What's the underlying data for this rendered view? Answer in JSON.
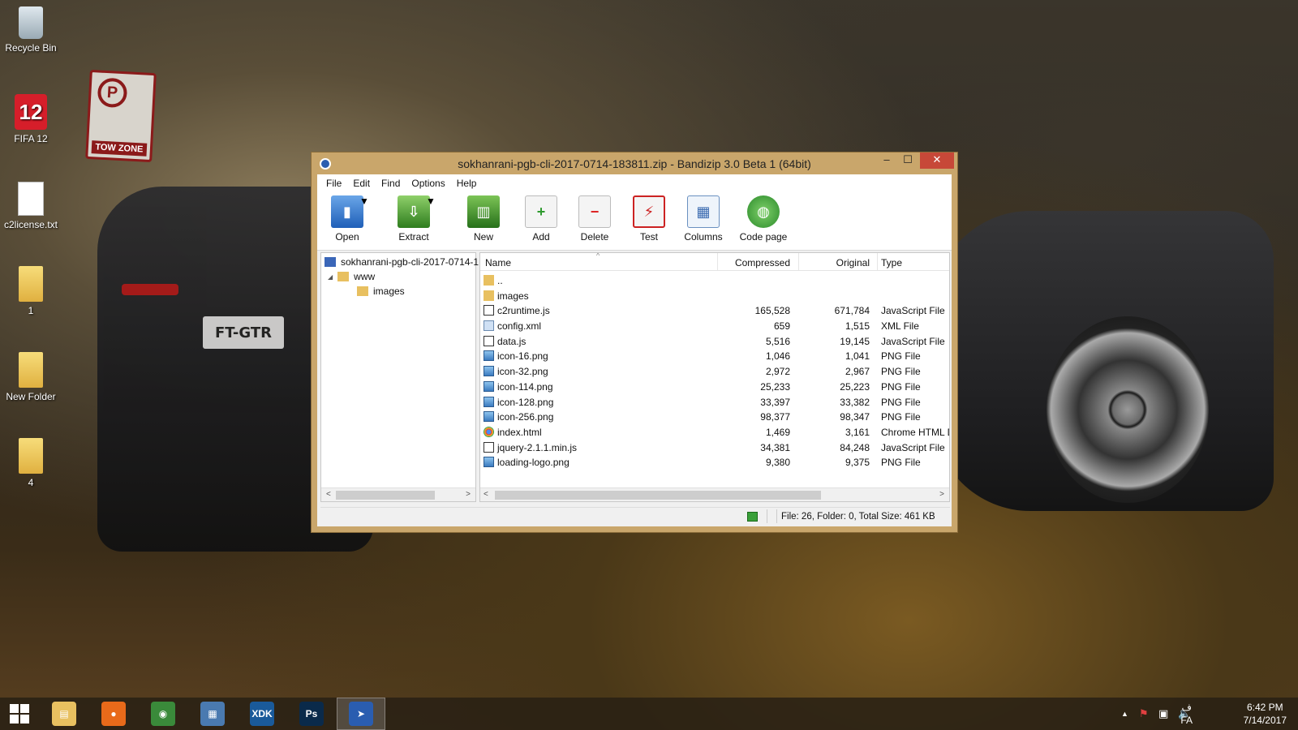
{
  "desktop": {
    "icons": [
      {
        "label": "Recycle Bin",
        "icon": "recycle-bin-icon"
      },
      {
        "label": "FIFA 12",
        "icon": "fifa-icon",
        "glyph": "12"
      },
      {
        "label": "c2license.txt",
        "icon": "text-file-icon"
      },
      {
        "label": "1",
        "icon": "folder-icon"
      },
      {
        "label": "New Folder",
        "icon": "folder-icon"
      },
      {
        "label": "4",
        "icon": "folder-icon"
      }
    ],
    "wallpaper": {
      "plate": "FT-GTR",
      "sign_text": "TOW ZONE",
      "sign_symbol": "P"
    }
  },
  "window": {
    "title": "sokhanrani-pgb-cli-2017-0714-183811.zip - Bandizip 3.0 Beta 1 (64bit)",
    "controls": {
      "minimize": "–",
      "maximize": "☐",
      "close": "✕"
    },
    "menu": [
      "File",
      "Edit",
      "Find",
      "Options",
      "Help"
    ],
    "toolbar": [
      {
        "label": "Open",
        "icon": "open-icon",
        "glyph": "▮"
      },
      {
        "label": "Extract",
        "icon": "extract-icon",
        "glyph": "⇩"
      },
      {
        "label": "New",
        "icon": "new-archive-icon",
        "glyph": "▥"
      },
      {
        "label": "Add",
        "icon": "add-file-icon",
        "glyph": "+"
      },
      {
        "label": "Delete",
        "icon": "delete-file-icon",
        "glyph": "−"
      },
      {
        "label": "Test",
        "icon": "test-icon",
        "glyph": "⚡"
      },
      {
        "label": "Columns",
        "icon": "columns-icon",
        "glyph": "▦"
      },
      {
        "label": "Code page",
        "icon": "globe-icon",
        "glyph": "◍"
      }
    ],
    "tree": [
      {
        "label": "sokhanrani-pgb-cli-2017-0714-1"
      },
      {
        "label": "www",
        "expander": "◢"
      },
      {
        "label": "images"
      }
    ],
    "columns": {
      "name": "Name",
      "compressed": "Compressed",
      "original": "Original",
      "type": "Type",
      "sort_indicator": "^"
    },
    "files": [
      {
        "name": "..",
        "compressed": "",
        "original": "",
        "type": "",
        "kind": "folder"
      },
      {
        "name": "images",
        "compressed": "",
        "original": "",
        "type": "",
        "kind": "folder"
      },
      {
        "name": "c2runtime.js",
        "compressed": "165,528",
        "original": "671,784",
        "type": "JavaScript File",
        "kind": "js"
      },
      {
        "name": "config.xml",
        "compressed": "659",
        "original": "1,515",
        "type": "XML File",
        "kind": "xml"
      },
      {
        "name": "data.js",
        "compressed": "5,516",
        "original": "19,145",
        "type": "JavaScript File",
        "kind": "js"
      },
      {
        "name": "icon-16.png",
        "compressed": "1,046",
        "original": "1,041",
        "type": "PNG File",
        "kind": "png"
      },
      {
        "name": "icon-32.png",
        "compressed": "2,972",
        "original": "2,967",
        "type": "PNG File",
        "kind": "png"
      },
      {
        "name": "icon-114.png",
        "compressed": "25,233",
        "original": "25,223",
        "type": "PNG File",
        "kind": "png"
      },
      {
        "name": "icon-128.png",
        "compressed": "33,397",
        "original": "33,382",
        "type": "PNG File",
        "kind": "png"
      },
      {
        "name": "icon-256.png",
        "compressed": "98,377",
        "original": "98,347",
        "type": "PNG File",
        "kind": "png"
      },
      {
        "name": "index.html",
        "compressed": "1,469",
        "original": "3,161",
        "type": "Chrome HTML D",
        "kind": "html"
      },
      {
        "name": "jquery-2.1.1.min.js",
        "compressed": "34,381",
        "original": "84,248",
        "type": "JavaScript File",
        "kind": "js"
      },
      {
        "name": "loading-logo.png",
        "compressed": "9,380",
        "original": "9,375",
        "type": "PNG File",
        "kind": "png"
      }
    ],
    "status": "File: 26, Folder: 0, Total Size: 461 KB",
    "scroll_arrows": {
      "left": "<",
      "right": ">"
    }
  },
  "taskbar": {
    "apps": [
      {
        "name": "file-explorer",
        "glyph": "▤",
        "color": "#e8c060"
      },
      {
        "name": "firefox",
        "glyph": "●",
        "color": "#e86a1a"
      },
      {
        "name": "chrome",
        "glyph": "◉",
        "color": "#3a8a3a"
      },
      {
        "name": "control-panel",
        "glyph": "▦",
        "color": "#4a7ab0"
      },
      {
        "name": "intel-xdk",
        "glyph": "XDK",
        "color": "#1a5a9a"
      },
      {
        "name": "photoshop",
        "glyph": "Ps",
        "color": "#0a2a4a"
      },
      {
        "name": "bandizip",
        "glyph": "➤",
        "color": "#2a5db0"
      }
    ],
    "tray": {
      "arrow": "▲",
      "flag": "⚑",
      "network": "▣",
      "volume": "🔈",
      "lang_top": "ف",
      "lang": "FA"
    },
    "time": "6:42 PM",
    "date": "7/14/2017"
  }
}
